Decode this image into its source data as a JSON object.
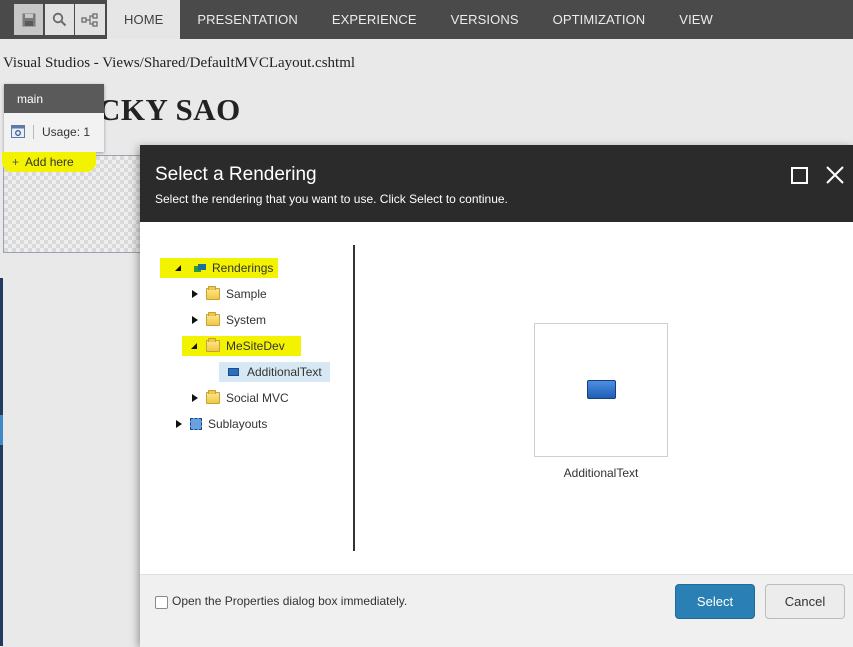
{
  "ribbon": {
    "quick_actions": [
      {
        "name": "save",
        "icon": "floppy-disk-icon"
      },
      {
        "name": "search",
        "icon": "search-icon"
      },
      {
        "name": "navigator",
        "icon": "tree-nodes-icon"
      }
    ],
    "tabs": [
      {
        "label": "HOME",
        "active": true
      },
      {
        "label": "PRESENTATION",
        "active": false
      },
      {
        "label": "EXPERIENCE",
        "active": false
      },
      {
        "label": "VERSIONS",
        "active": false
      },
      {
        "label": "OPTIMIZATION",
        "active": false
      },
      {
        "label": "VIEW",
        "active": false
      }
    ]
  },
  "page": {
    "path": "Visual Studios - Views/Shared/DefaultMVCLayout.cshtml",
    "site_title": "CKY SAO"
  },
  "placeholder_chrome": {
    "name": "main",
    "usage": "Usage: 1",
    "add_here": "Add here"
  },
  "dialog": {
    "title": "Select a Rendering",
    "subtitle": "Select the rendering that you want to use. Click Select to continue.",
    "tree": [
      {
        "label": "Renderings",
        "expanded": true,
        "icon": "renderings-icon",
        "highlighted": true
      },
      {
        "label": "Sample",
        "expanded": false,
        "icon": "folder-icon"
      },
      {
        "label": "System",
        "expanded": false,
        "icon": "folder-icon"
      },
      {
        "label": "MeSiteDev",
        "expanded": true,
        "icon": "folder-icon",
        "highlighted": true
      },
      {
        "label": "AdditionalText",
        "icon": "rendering-item-icon",
        "selected": true
      },
      {
        "label": "Social MVC",
        "expanded": false,
        "icon": "folder-icon"
      },
      {
        "label": "Sublayouts",
        "expanded": false,
        "icon": "sublayout-icon"
      }
    ],
    "preview_label": "AdditionalText",
    "checkbox_label": "Open the Properties dialog box immediately.",
    "checkbox_checked": false,
    "select_label": "Select",
    "cancel_label": "Cancel"
  },
  "colors": {
    "highlight": "#f3f300",
    "select_button": "#2a80b4",
    "dialog_header": "#2b2b2b",
    "ribbon": "#4a4a4a"
  }
}
